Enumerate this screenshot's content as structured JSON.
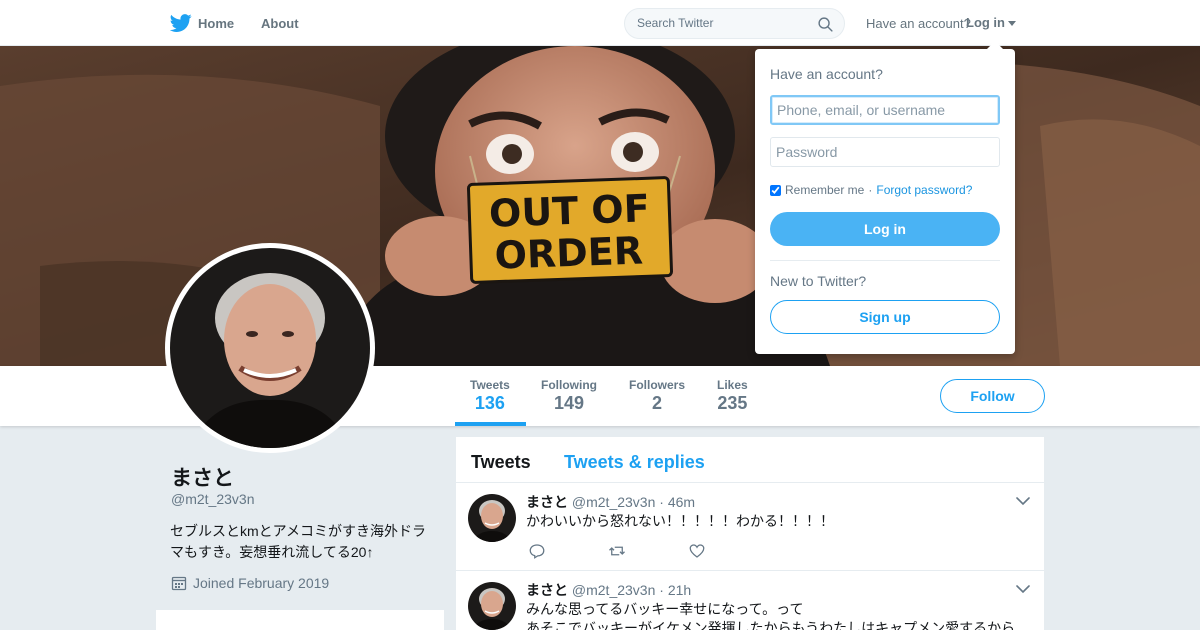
{
  "nav": {
    "home_label": "Home",
    "about_label": "About",
    "search_placeholder": "Search Twitter",
    "have_account": "Have an account?",
    "login_label": "Log in"
  },
  "banner": {
    "sign_line1": "OUT OF",
    "sign_line2": "ORDER"
  },
  "stats": [
    {
      "label": "Tweets",
      "value": "136"
    },
    {
      "label": "Following",
      "value": "149"
    },
    {
      "label": "Followers",
      "value": "2"
    },
    {
      "label": "Likes",
      "value": "235"
    }
  ],
  "follow_label": "Follow",
  "profile": {
    "name": "まさと",
    "handle": "@m2t_23v3n",
    "bio": "セブルスとkmとアメコミがすき海外ドラマもすき。妄想垂れ流してる20↑",
    "joined": "Joined February 2019"
  },
  "timeline": {
    "tab_tweets": "Tweets",
    "tab_replies": "Tweets & replies",
    "tweets": [
      {
        "name": "まさと",
        "handle": "@m2t_23v3n",
        "time": "46m",
        "text": "かわいいから怒れない！！！！！わかる！！！！"
      },
      {
        "name": "まさと",
        "handle": "@m2t_23v3n",
        "time": "21h",
        "text": "みんな思ってるバッキー幸せになって。って",
        "text2": "あそこでバッキーがイケメン発揮したからもうわたしはキャプメン愛するから"
      }
    ]
  },
  "login_popup": {
    "title": "Have an account?",
    "username_placeholder": "Phone, email, or username",
    "password_placeholder": "Password",
    "remember_label": "Remember me",
    "separator": "·",
    "forgot_label": "Forgot password?",
    "login_button": "Log in",
    "new_label": "New to Twitter?",
    "signup_button": "Sign up"
  },
  "colors": {
    "accent": "#1da1f2",
    "login_button": "#4ab3f4",
    "background": "#e6ecf0"
  }
}
